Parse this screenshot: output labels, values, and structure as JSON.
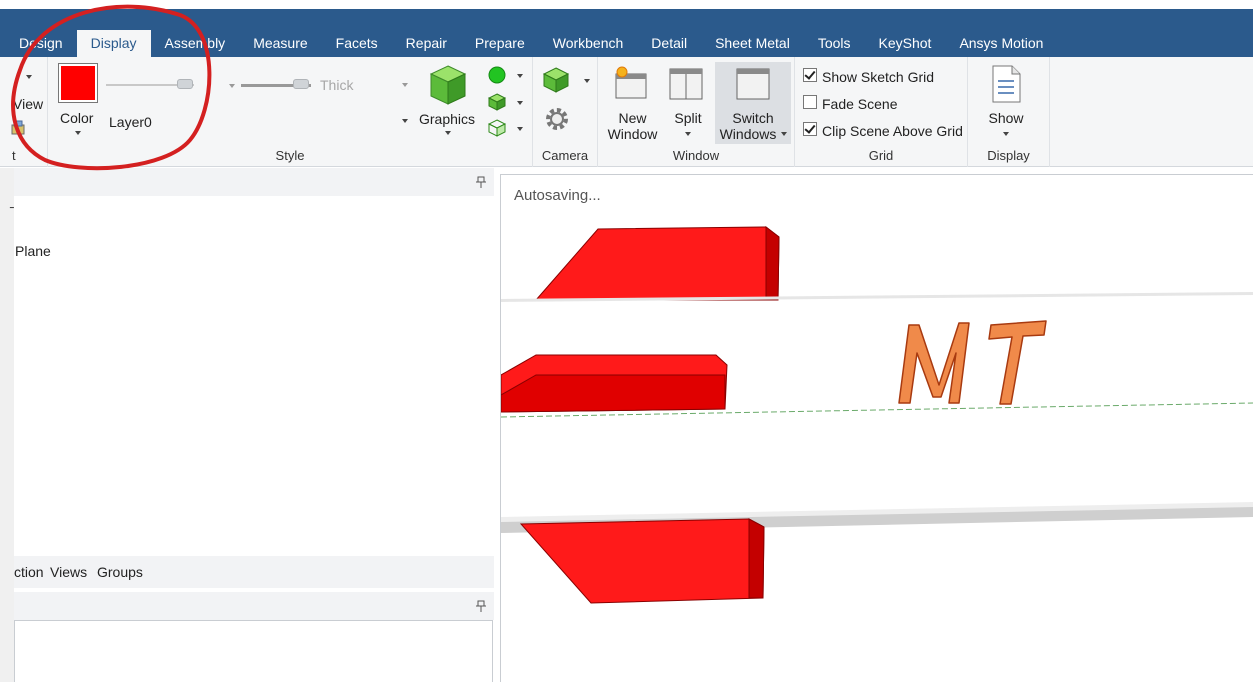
{
  "tabs": [
    {
      "label": "Design"
    },
    {
      "label": "Display"
    },
    {
      "label": "Assembly"
    },
    {
      "label": "Measure"
    },
    {
      "label": "Facets"
    },
    {
      "label": "Repair"
    },
    {
      "label": "Prepare"
    },
    {
      "label": "Workbench"
    },
    {
      "label": "Detail"
    },
    {
      "label": "Sheet Metal"
    },
    {
      "label": "Tools"
    },
    {
      "label": "KeyShot"
    },
    {
      "label": "Ansys Motion"
    }
  ],
  "ribbon": {
    "partial_view_label": "View",
    "partial_group_label": "t",
    "style": {
      "color_label": "Color",
      "layer_label": "Layer0",
      "line_weight_label": "Thick",
      "graphics_label": "Graphics",
      "group_label": "Style",
      "swatch_color": "#ff0000"
    },
    "camera": {
      "group_label": "Camera"
    },
    "window": {
      "new_window_line1": "New",
      "new_window_line2": "Window",
      "split_label": "Split",
      "switch_line1": "Switch",
      "switch_line2": "Windows",
      "group_label": "Window"
    },
    "grid": {
      "show_sketch_grid": "Show Sketch Grid",
      "show_sketch_grid_checked": true,
      "fade_scene": "Fade Scene",
      "fade_scene_checked": false,
      "clip_scene": "Clip Scene Above Grid",
      "clip_scene_checked": true,
      "group_label": "Grid"
    },
    "display": {
      "show_label": "Show",
      "group_label": "Display"
    }
  },
  "left_panel": {
    "tree_item_plane": "Plane",
    "tree_item_partial": "",
    "bottom_tabs": [
      {
        "label": "ction"
      },
      {
        "label": "Views"
      },
      {
        "label": "Groups"
      }
    ]
  },
  "viewport": {
    "status_text": "Autosaving...",
    "model_text": "MT",
    "accent_red": "#ff0000",
    "letter_orange": "#e8742c"
  },
  "colors": {
    "titlebar": "#2b5a8c",
    "ribbon_bg": "#f5f6f7",
    "annotation_red": "#d42020"
  }
}
